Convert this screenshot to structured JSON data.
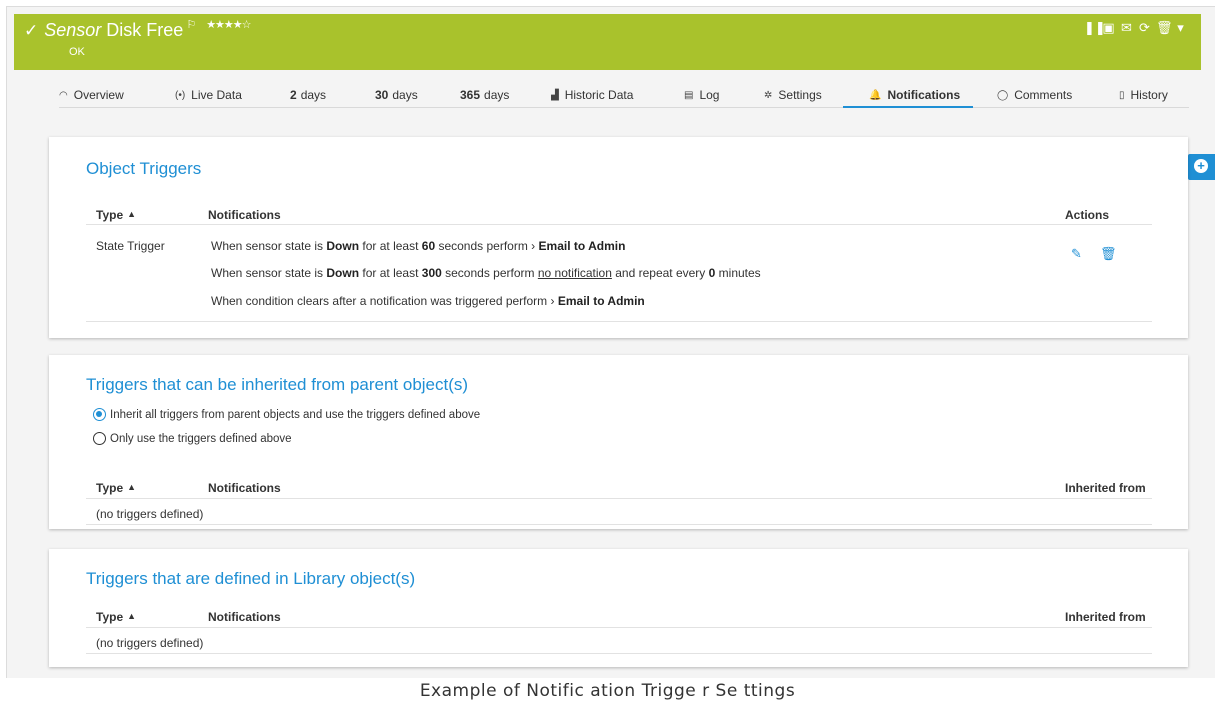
{
  "header": {
    "check_icon": "check-icon",
    "sensor_prefix": "Sensor",
    "sensor_name": "Disk Free",
    "flag_icon": "flag-icon",
    "priority_stars": "★★★★☆",
    "status": "OK",
    "toolbar_icons": [
      "pause-icon",
      "report-icon",
      "email-icon",
      "refresh-icon",
      "delete-icon",
      "dropdown-icon"
    ],
    "bg_color": "#a9c22c"
  },
  "tabs": [
    {
      "icon": "◠",
      "label": "Overview"
    },
    {
      "icon": "(•)",
      "label": "Live Data"
    },
    {
      "num": "2",
      "label": "days"
    },
    {
      "num": "30",
      "label": "days"
    },
    {
      "num": "365",
      "label": "days"
    },
    {
      "icon": "▟",
      "label": "Historic Data"
    },
    {
      "icon": "▤",
      "label": "Log"
    },
    {
      "icon": "✲",
      "label": "Settings"
    },
    {
      "icon": "🔔",
      "label": "Notifications"
    },
    {
      "icon": "◯",
      "label": "Comments"
    },
    {
      "icon": "▯",
      "label": "History"
    }
  ],
  "active_tab": "Notifications",
  "object_triggers": {
    "title": "Object Triggers",
    "col_type": "Type",
    "col_notifications": "Notifications",
    "col_actions": "Actions",
    "row": {
      "type": "State Trigger",
      "line1": {
        "pre": "When sensor state is ",
        "state": "Down",
        "mid": " for at least ",
        "secs": "60",
        "post": " seconds perform ",
        "arrow": "›",
        "action": "Email to Admin"
      },
      "line2": {
        "pre": "When sensor state is ",
        "state": "Down",
        "mid": " for at least ",
        "secs": "300",
        "post": " seconds perform ",
        "action": "no notification",
        "repeat_pre": " and repeat every ",
        "repeat": "0",
        "repeat_post": " minutes"
      },
      "line3": {
        "pre": "When condition clears after a notification was triggered perform ",
        "arrow": "›",
        "action": "Email to Admin"
      },
      "edit_icon": "pencil-icon",
      "delete_icon": "trash-icon"
    }
  },
  "parent_triggers": {
    "title": "Triggers that can be inherited from parent object(s)",
    "option1": "Inherit all triggers from parent objects and use the triggers defined above",
    "option2": "Only use the triggers defined above",
    "selected": "option1",
    "col_type": "Type",
    "col_notifications": "Notifications",
    "col_inherited": "Inherited from",
    "empty": "(no triggers defined)"
  },
  "library_triggers": {
    "title": "Triggers that are defined in Library object(s)",
    "col_type": "Type",
    "col_notifications": "Notifications",
    "col_inherited": "Inherited from",
    "empty": "(no triggers defined)"
  },
  "side_button_icon": "plus-circle-icon",
  "caption": "Example of Notific ation Trigge r Se ttings",
  "accent_color": "#1f8fd4"
}
